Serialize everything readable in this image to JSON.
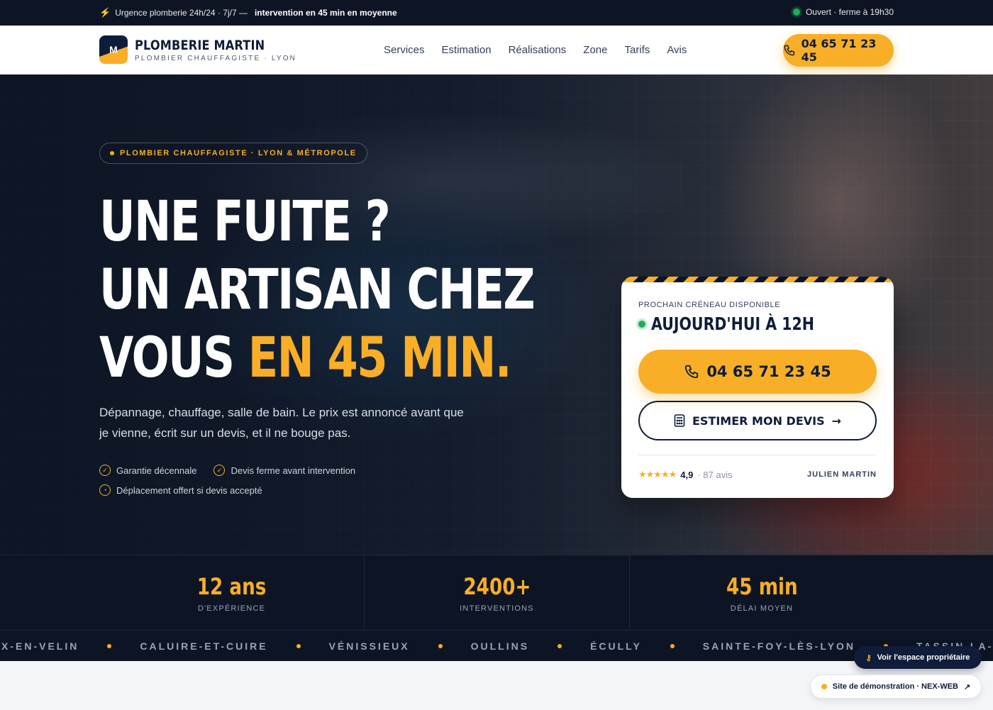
{
  "topbar": {
    "urgency_text": "Urgence plomberie 24h/24 · 7j/7 —",
    "urgency_bold": "intervention en 45 min en moyenne",
    "status": "Ouvert · ferme à 19h30"
  },
  "header": {
    "logo_mark": "M",
    "brand_name": "PLOMBERIE MARTIN",
    "brand_tagline": "PLOMBIER CHAUFFAGISTE · LYON",
    "nav": [
      "Services",
      "Estimation",
      "Réalisations",
      "Zone",
      "Tarifs",
      "Avis"
    ],
    "phone": "04 65 71 23 45"
  },
  "hero": {
    "pill": "PLOMBIER CHAUFFAGISTE · LYON & MÉTROPOLE",
    "headline_line1": "UNE FUITE ?",
    "headline_line2": "UN ARTISAN CHEZ",
    "headline_line3_plain": "VOUS ",
    "headline_line3_accent": "EN 45 MIN.",
    "lead": "Dépannage, chauffage, salle de bain. Le prix est annoncé avant que je vienne, écrit sur un devis, et il ne bouge pas.",
    "guarantees": [
      "Garantie décennale",
      "Devis ferme avant intervention",
      "Déplacement offert si devis accepté"
    ]
  },
  "card": {
    "label": "PROCHAIN CRÉNEAU DISPONIBLE",
    "slot": "AUJOURD'HUI À 12H",
    "call_label": "04 65 71 23 45",
    "estimate_label": "ESTIMER MON DEVIS",
    "stars": "★★★★★",
    "rating": "4,9",
    "reviews": "· 87 avis",
    "owner": "JULIEN MARTIN"
  },
  "stats": [
    {
      "value": "12 ans",
      "caption": "D'EXPÉRIENCE"
    },
    {
      "value": "2400+",
      "caption": "INTERVENTIONS"
    },
    {
      "value": "45 min",
      "caption": "DÉLAI MOYEN"
    }
  ],
  "towns": [
    "X-EN-VELIN",
    "CALUIRE-ET-CUIRE",
    "VÉNISSIEUX",
    "OULLINS",
    "ÉCULLY",
    "SAINTE-FOY-LÈS-LYON",
    "TASSIN-LA-DEMI-LUNE"
  ],
  "floating": {
    "owner_space": "Voir l'espace propriétaire",
    "demo": "Site de démonstration · NEX-WEB"
  },
  "colors": {
    "accent": "#f8ae26",
    "navy": "#0d1524",
    "status_green": "#1fae55"
  }
}
